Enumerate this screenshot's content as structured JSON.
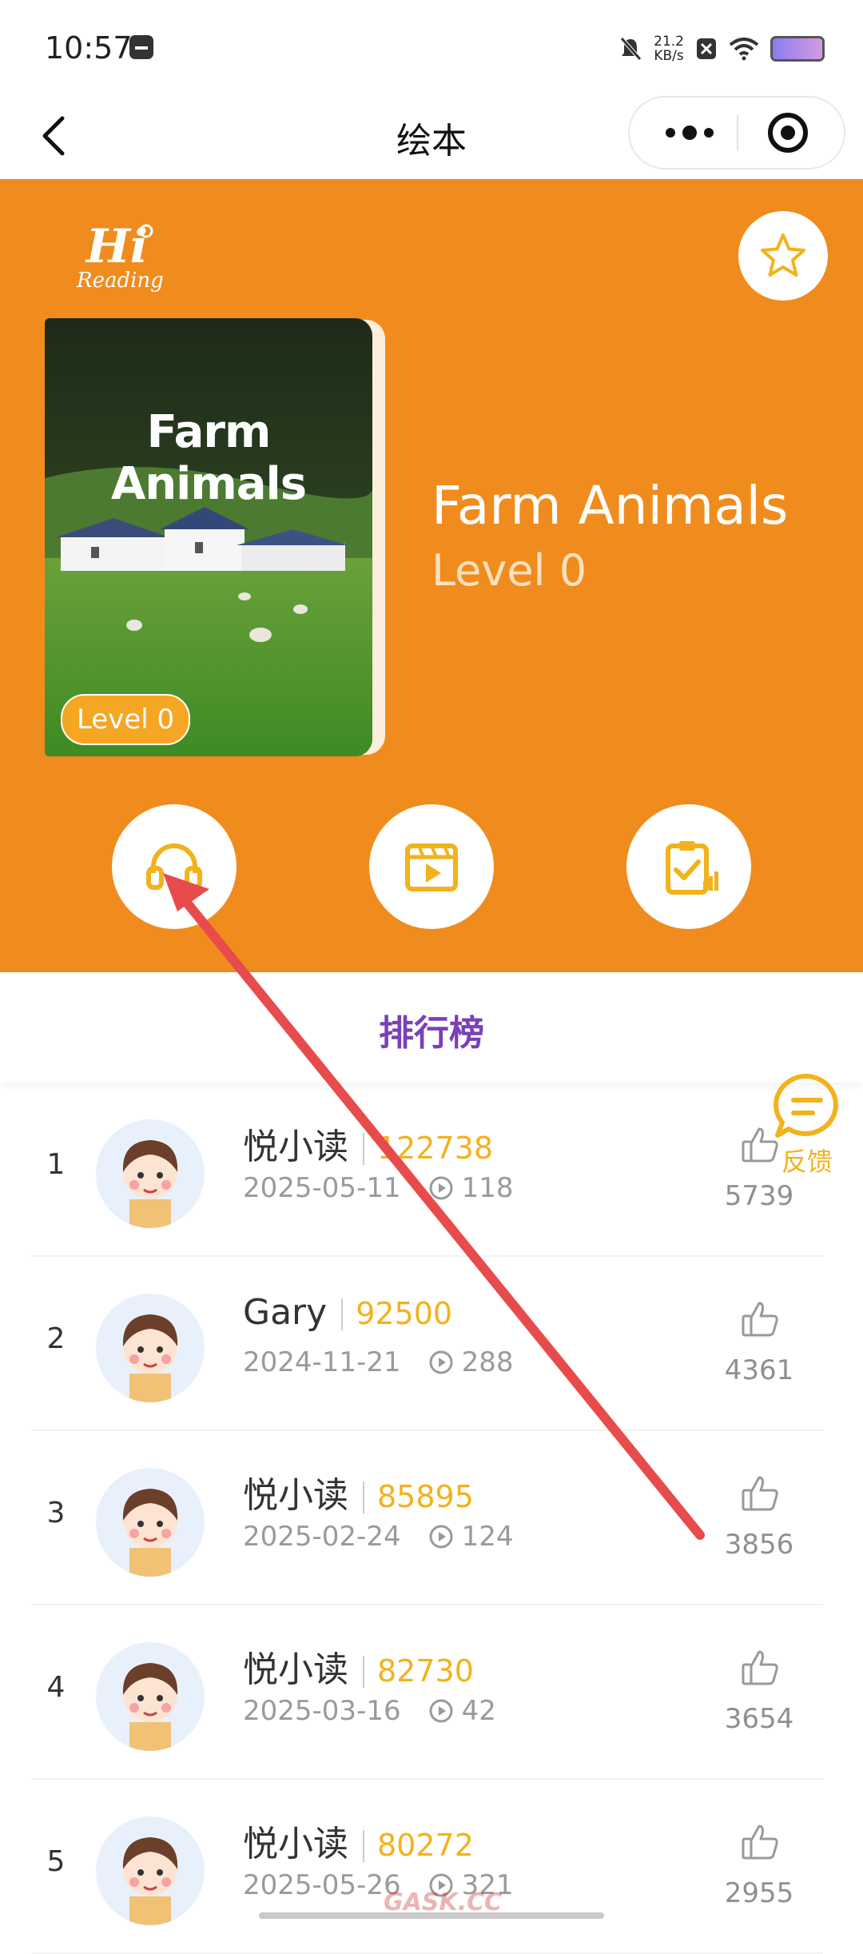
{
  "status_bar": {
    "time": "10:57",
    "net_speed_value": "21.2",
    "net_speed_unit": "KB/s",
    "icons": [
      "message-icon",
      "mute-icon",
      "sim-off-icon",
      "wifi-icon",
      "battery-icon"
    ]
  },
  "nav": {
    "title": "绘本",
    "icons": [
      "back-icon",
      "more-icon",
      "target-icon"
    ]
  },
  "book": {
    "logo_main": "Hi",
    "logo_sub": "Reading",
    "cover_title": "Farm Animals",
    "cover_badge": "Level 0",
    "title": "Farm Animals",
    "level": "Level 0",
    "actions": [
      "headphones-icon",
      "video-play-icon",
      "clipboard-check-icon"
    ],
    "favorite_icon": "star-icon"
  },
  "ranking": {
    "tab_label": "排行榜",
    "rows": [
      {
        "rank": "1",
        "name": "悦小读",
        "score": "122738",
        "date": "2025-05-11",
        "plays": "118",
        "likes": "5739"
      },
      {
        "rank": "2",
        "name": "Gary",
        "score": "92500",
        "date": "2024-11-21",
        "plays": "288",
        "likes": "4361"
      },
      {
        "rank": "3",
        "name": "悦小读",
        "score": "85895",
        "date": "2025-02-24",
        "plays": "124",
        "likes": "3856"
      },
      {
        "rank": "4",
        "name": "悦小读",
        "score": "82730",
        "date": "2025-03-16",
        "plays": "42",
        "likes": "3654"
      },
      {
        "rank": "5",
        "name": "悦小读",
        "score": "80272",
        "date": "2025-05-26",
        "plays": "321",
        "likes": "2955"
      }
    ]
  },
  "feedback": {
    "label": "反馈",
    "icon": "chat-bubble-icon"
  },
  "watermark": "GASK.CC",
  "colors": {
    "hero_orange": "#f08c1e",
    "score_gold": "#f2b21b",
    "tab_purple": "#7b3fb8",
    "arrow_red": "#e84b4b"
  }
}
